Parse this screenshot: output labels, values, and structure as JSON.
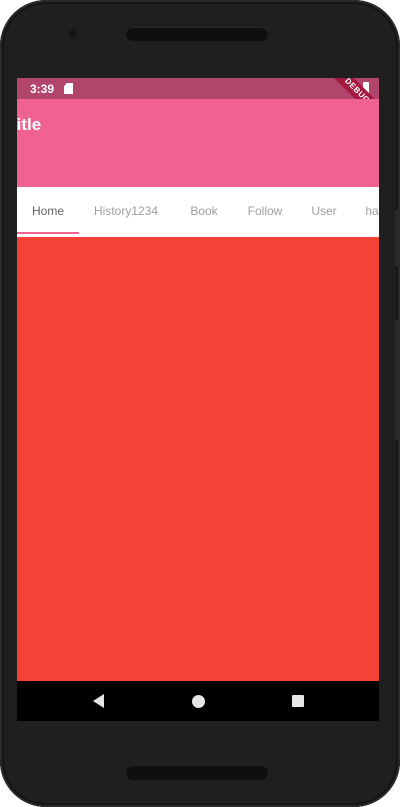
{
  "status_bar": {
    "time": "3:39",
    "debug_banner": "DEBUG"
  },
  "app_bar": {
    "title": "title"
  },
  "tabs": [
    {
      "label": "Home",
      "active": true
    },
    {
      "label": "History1234",
      "active": false
    },
    {
      "label": "Book",
      "active": false
    },
    {
      "label": "Follow",
      "active": false
    },
    {
      "label": "User",
      "active": false
    },
    {
      "label": "ha",
      "active": false
    }
  ],
  "colors": {
    "status_bar": "#B2456C",
    "app_bar": "#F06292",
    "content": "#F44336",
    "tab_indicator": "#F06292"
  },
  "nav_bar": {
    "icons": [
      "back-icon",
      "home-icon",
      "recents-icon"
    ]
  }
}
